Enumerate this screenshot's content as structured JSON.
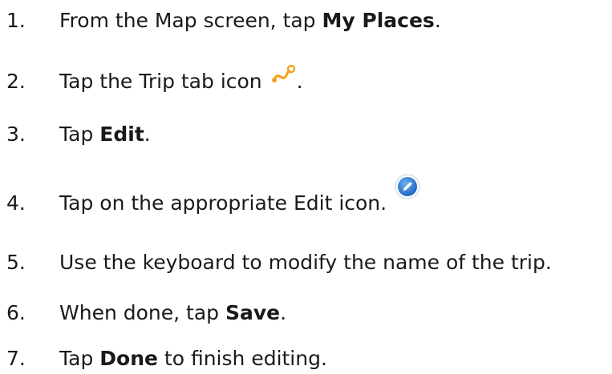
{
  "steps": [
    {
      "number": "1.",
      "before": "From the Map screen, tap ",
      "bold": "My Places",
      "after": "."
    },
    {
      "number": "2.",
      "before": "Tap the Trip tab icon ",
      "icon": "trip-route-icon",
      "after": "."
    },
    {
      "number": "3.",
      "before": "Tap ",
      "bold": "Edit",
      "after": "."
    },
    {
      "number": "4.",
      "before": "Tap on the appropriate Edit icon.",
      "icon": "pencil-edit-icon"
    },
    {
      "number": "5.",
      "text": "Use the keyboard to modify the name of the trip."
    },
    {
      "number": "6.",
      "before": "When done, tap ",
      "bold": "Save",
      "after": "."
    },
    {
      "number": "7.",
      "before": "Tap ",
      "bold": "Done",
      "after": " to finish editing."
    }
  ],
  "colors": {
    "trip_icon": "#f2a31f",
    "edit_icon_fill": "#2f80d6",
    "text": "#1a1a1a"
  }
}
